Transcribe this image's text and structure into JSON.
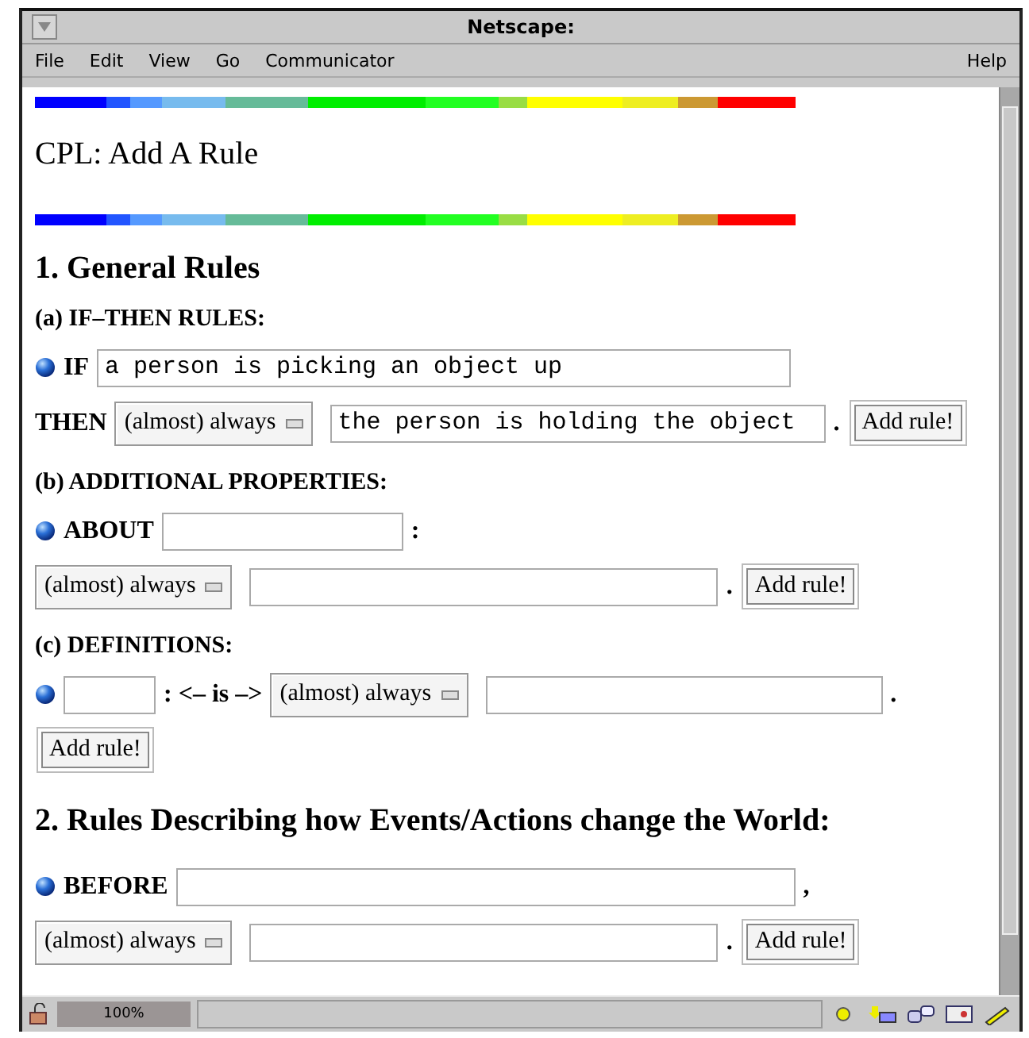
{
  "window": {
    "title": "Netscape:"
  },
  "menu": [
    {
      "label": "File"
    },
    {
      "label": "Edit"
    },
    {
      "label": "View"
    },
    {
      "label": "Go"
    },
    {
      "label": "Communicator"
    },
    {
      "label": "Help"
    }
  ],
  "page": {
    "title": "CPL: Add A Rule",
    "sections": [
      {
        "heading": "1. General Rules",
        "subsections": [
          {
            "heading": "(a) IF–THEN RULES:",
            "rows": [
              {
                "bullet": true,
                "items": [
                  {
                    "kind": "label",
                    "text": "IF"
                  },
                  {
                    "kind": "field",
                    "value": "a person is picking an object up"
                  }
                ]
              },
              {
                "items": [
                  {
                    "kind": "label",
                    "text": "THEN"
                  },
                  {
                    "kind": "select",
                    "value": "(almost) always"
                  },
                  {
                    "kind": "field",
                    "value": "the person is holding the object"
                  },
                  {
                    "kind": "punct",
                    "text": "."
                  },
                  {
                    "kind": "button",
                    "text": "Add rule!"
                  }
                ]
              }
            ]
          },
          {
            "heading": "(b) ADDITIONAL PROPERTIES:",
            "rows": [
              {
                "bullet": true,
                "items": [
                  {
                    "kind": "label",
                    "text": "ABOUT"
                  },
                  {
                    "kind": "field"
                  },
                  {
                    "kind": "punct",
                    "text": ":"
                  }
                ]
              },
              {
                "items": [
                  {
                    "kind": "select",
                    "value": "(almost) always"
                  },
                  {
                    "kind": "field"
                  },
                  {
                    "kind": "punct",
                    "text": "."
                  },
                  {
                    "kind": "button",
                    "text": "Add rule!"
                  }
                ]
              }
            ]
          },
          {
            "heading": "(c) DEFINITIONS:",
            "rows": [
              {
                "bullet": true,
                "items": [
                  {
                    "kind": "field"
                  },
                  {
                    "kind": "label",
                    "text": ": <– is –>"
                  },
                  {
                    "kind": "select",
                    "value": "(almost) always"
                  },
                  {
                    "kind": "field"
                  },
                  {
                    "kind": "punct",
                    "text": "."
                  }
                ]
              },
              {
                "items": [
                  {
                    "kind": "button",
                    "text": "Add rule!"
                  }
                ]
              }
            ]
          }
        ]
      },
      {
        "heading": "2. Rules Describing how Events/Actions change the World:",
        "subsections": [
          {
            "rows": [
              {
                "bullet": true,
                "items": [
                  {
                    "kind": "label",
                    "text": "BEFORE"
                  },
                  {
                    "kind": "field"
                  },
                  {
                    "kind": "punct",
                    "text": ","
                  }
                ]
              },
              {
                "items": [
                  {
                    "kind": "select",
                    "value": "(almost) always"
                  },
                  {
                    "kind": "field"
                  },
                  {
                    "kind": "punct",
                    "text": "."
                  },
                  {
                    "kind": "button",
                    "text": "Add rule!"
                  }
                ]
              }
            ]
          }
        ]
      }
    ]
  },
  "status_bar": {
    "zoom": "100%"
  }
}
